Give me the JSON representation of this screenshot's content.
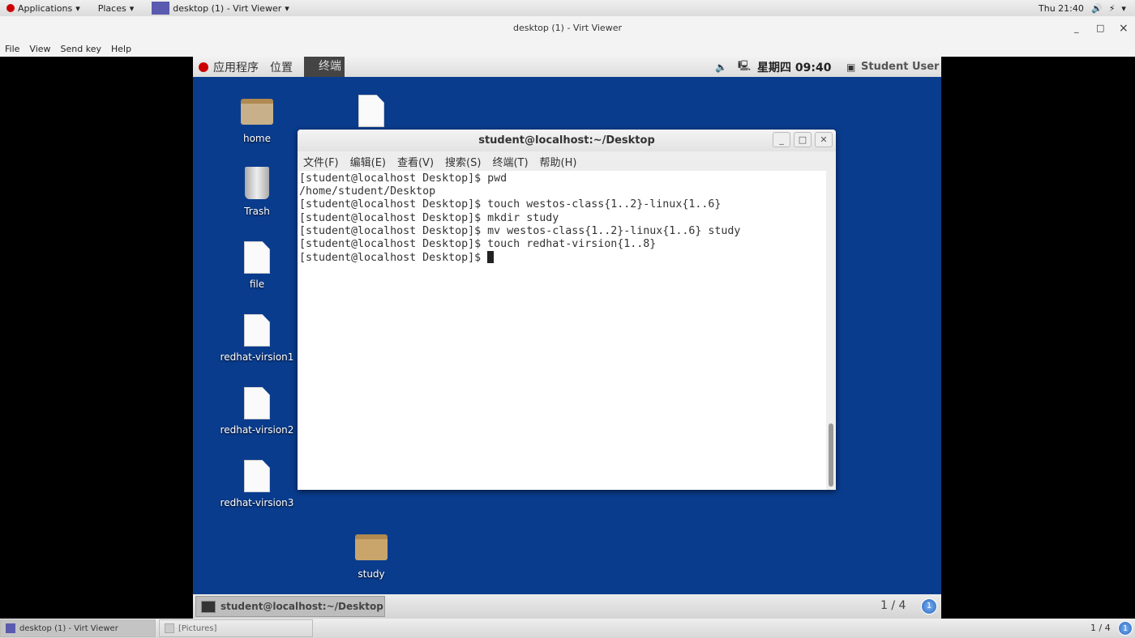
{
  "host_top": {
    "applications": "Applications",
    "places": "Places",
    "active_window": "desktop (1) - Virt Viewer",
    "clock": "Thu 21:40"
  },
  "window": {
    "title": "desktop (1) - Virt Viewer",
    "minimize": "_",
    "maximize": "□",
    "close": "×",
    "menu": [
      "File",
      "View",
      "Send key",
      "Help"
    ]
  },
  "guest_panel": {
    "applications": "应用程序",
    "places": "位置",
    "terminal_task": "终端",
    "clock": "星期四 09:40",
    "user": "Student User"
  },
  "desktop_icons": [
    {
      "label": "home",
      "kind": "folder-home"
    },
    {
      "label": "Trash",
      "kind": "trash"
    },
    {
      "label": "file",
      "kind": "document"
    },
    {
      "label": "redhat-virsion1",
      "kind": "document"
    },
    {
      "label": "redhat-virsion2",
      "kind": "document"
    },
    {
      "label": "redhat-virsion3",
      "kind": "document"
    },
    {
      "label": "",
      "kind": "document"
    },
    {
      "label": "study",
      "kind": "folder"
    }
  ],
  "terminal": {
    "title": "student@localhost:~/Desktop",
    "menu": [
      "文件(F)",
      "编辑(E)",
      "查看(V)",
      "搜索(S)",
      "终端(T)",
      "帮助(H)"
    ],
    "lines": [
      "[student@localhost Desktop]$ pwd",
      "/home/student/Desktop",
      "[student@localhost Desktop]$ touch westos-class{1..2}-linux{1..6}",
      "[student@localhost Desktop]$ mkdir study",
      "[student@localhost Desktop]$ mv westos-class{1..2}-linux{1..6} study",
      "[student@localhost Desktop]$ touch redhat-virsion{1..8}",
      "[student@localhost Desktop]$ "
    ]
  },
  "guest_taskbar": {
    "task": "student@localhost:~/Desktop",
    "workspace": "1 / 4",
    "workspace_badge": "1"
  },
  "host_taskbar": {
    "tasks": [
      "desktop (1) - Virt Viewer",
      "[Pictures]"
    ],
    "workspace": "1 / 4",
    "workspace_badge": "1"
  },
  "colors": {
    "desktop_bg": "#0a3c8e"
  }
}
